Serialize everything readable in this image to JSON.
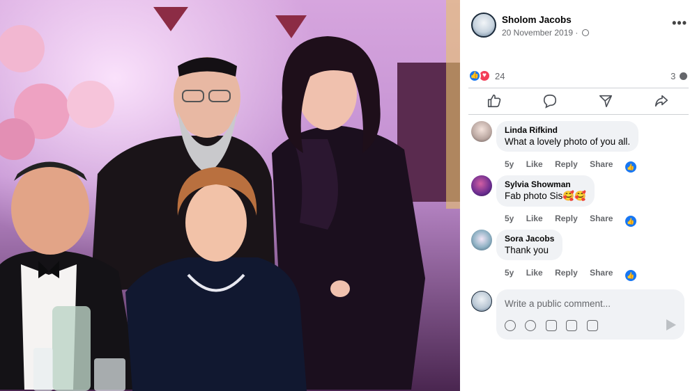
{
  "post": {
    "author": "Sholom Jacobs",
    "date": "20 November 2019 ·",
    "more_label": "•••",
    "reaction_count": "24",
    "comment_count": "3"
  },
  "actions": {
    "like_icon": "thumbs-up-icon",
    "comment_icon": "comment-bubble-icon",
    "send_icon": "send-icon",
    "share_icon": "share-icon"
  },
  "comments": [
    {
      "name": "Linda Rifkind",
      "text": "What a lovely photo of you all.",
      "time": "5y",
      "like": "Like",
      "reply": "Reply",
      "share": "Share"
    },
    {
      "name": "Sylvia Showman",
      "text": "Fab photo Sis🥰🥰",
      "time": "5y",
      "like": "Like",
      "reply": "Reply",
      "share": "Share"
    },
    {
      "name": "Sora Jacobs",
      "text": "Thank you",
      "time": "5y",
      "like": "Like",
      "reply": "Reply",
      "share": "Share"
    }
  ],
  "composer": {
    "placeholder": "Write a public comment...",
    "tools": [
      "avatar-sticker-icon",
      "emoji-icon",
      "camera-icon",
      "gif-icon",
      "sticker-icon"
    ]
  },
  "colors": {
    "accent": "#1877f2",
    "heart": "#f33e58",
    "bubble": "#f0f2f5",
    "meta": "#65676b"
  }
}
